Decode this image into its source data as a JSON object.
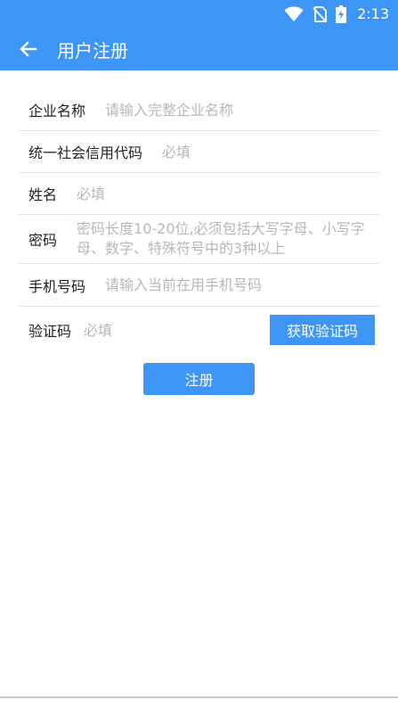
{
  "status_bar": {
    "time": "2:13"
  },
  "app_bar": {
    "title": "用户注册",
    "back_icon": "arrow-left-icon"
  },
  "form": {
    "company": {
      "label": "企业名称",
      "placeholder": "请输入完整企业名称",
      "value": ""
    },
    "credit_code": {
      "label": "统一社会信用代码",
      "placeholder": "必填",
      "value": ""
    },
    "name": {
      "label": "姓名",
      "placeholder": "必填",
      "value": ""
    },
    "password": {
      "label": "密码",
      "placeholder": "密码长度10-20位,必须包括大写字母、小写字母、数字、特殊符号中的3种以上",
      "value": ""
    },
    "phone": {
      "label": "手机号码",
      "placeholder": "请输入当前在用手机号码",
      "value": ""
    },
    "verify_code": {
      "label": "验证码",
      "placeholder": "必填",
      "value": "",
      "button_label": "获取验证码"
    }
  },
  "register_button": {
    "label": "注册"
  },
  "colors": {
    "primary": "#3d96f5",
    "placeholder": "#b7b7b7",
    "divider": "#e6e6e6"
  }
}
